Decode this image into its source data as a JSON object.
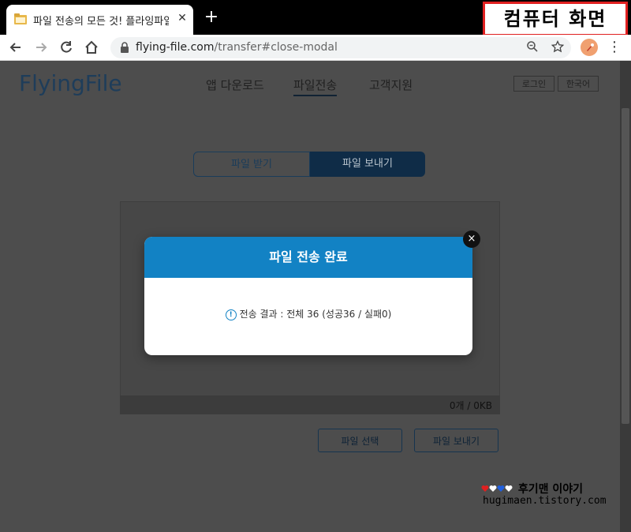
{
  "browser": {
    "tab_title": "파일 전송의 모든 것! 플라잉파일",
    "tab_close": "✕",
    "new_tab": "+",
    "url_host": "flying-file.com",
    "url_path": "/transfer#close-modal"
  },
  "badge": "컴퓨터 화면",
  "site": {
    "logo": "FlyingFile",
    "nav": [
      "앱 다운로드",
      "파일전송",
      "고객지원"
    ],
    "login": "로그인",
    "language": "한국어"
  },
  "tabs": {
    "receive": "파일 받기",
    "send": "파일 보내기"
  },
  "dropzone": {
    "count": "0개 / 0KB"
  },
  "actions": {
    "select": "파일 선택",
    "send": "파일 보내기"
  },
  "modal": {
    "title": "파일 전송 완료",
    "message": "전송 결과 : 전체 36 (성공36 / 실패0)",
    "close": "×"
  },
  "watermark": {
    "title": "후기맨 이야기",
    "url": "hugimaen.tistory.com"
  },
  "colors": {
    "accent": "#1282c4",
    "badge_border": "#e02020"
  }
}
